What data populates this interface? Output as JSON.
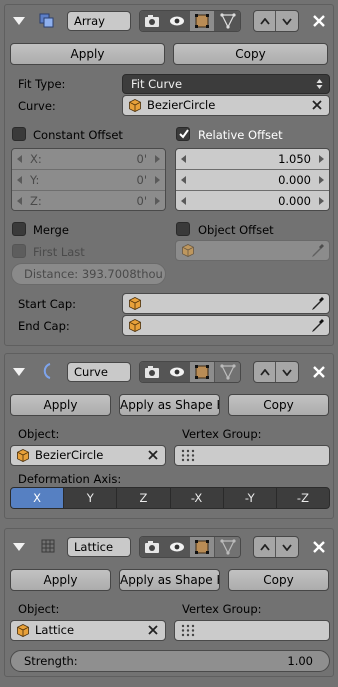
{
  "array": {
    "name": "Array",
    "apply": "Apply",
    "copy": "Copy",
    "fit_type_label": "Fit Type:",
    "fit_type_value": "Fit Curve",
    "curve_label": "Curve:",
    "curve_value": "BezierCircle",
    "constant_offset": "Constant Offset",
    "relative_offset": "Relative Offset",
    "constant": [
      {
        "label": "X:",
        "value": "0'"
      },
      {
        "label": "Y:",
        "value": "0'"
      },
      {
        "label": "Z:",
        "value": "0'"
      }
    ],
    "relative": [
      "1.050",
      "0.000",
      "0.000"
    ],
    "merge": "Merge",
    "object_offset": "Object Offset",
    "first_last": "First Last",
    "distance": "Distance: 393.7008thou",
    "start_cap": "Start Cap:",
    "end_cap": "End Cap:"
  },
  "curve": {
    "name": "Curve",
    "apply": "Apply",
    "apply_shape": "Apply as Shape K...",
    "copy": "Copy",
    "object_label": "Object:",
    "vertex_group_label": "Vertex Group:",
    "object_value": "BezierCircle",
    "deformation_label": "Deformation Axis:",
    "axes": [
      "X",
      "Y",
      "Z",
      "-X",
      "-Y",
      "-Z"
    ],
    "active_axis": "X"
  },
  "lattice": {
    "name": "Lattice",
    "apply": "Apply",
    "apply_shape": "Apply as Shape K...",
    "copy": "Copy",
    "object_label": "Object:",
    "vertex_group_label": "Vertex Group:",
    "object_value": "Lattice",
    "strength_label": "Strength:",
    "strength_value": "1.00"
  },
  "colors": {
    "panel_bg": "#727272",
    "field_bg": "#cbcbcb",
    "dropdown_bg": "#3c3c3c",
    "active_axis": "#5680c2",
    "cube_orange": "#e8a13a"
  }
}
